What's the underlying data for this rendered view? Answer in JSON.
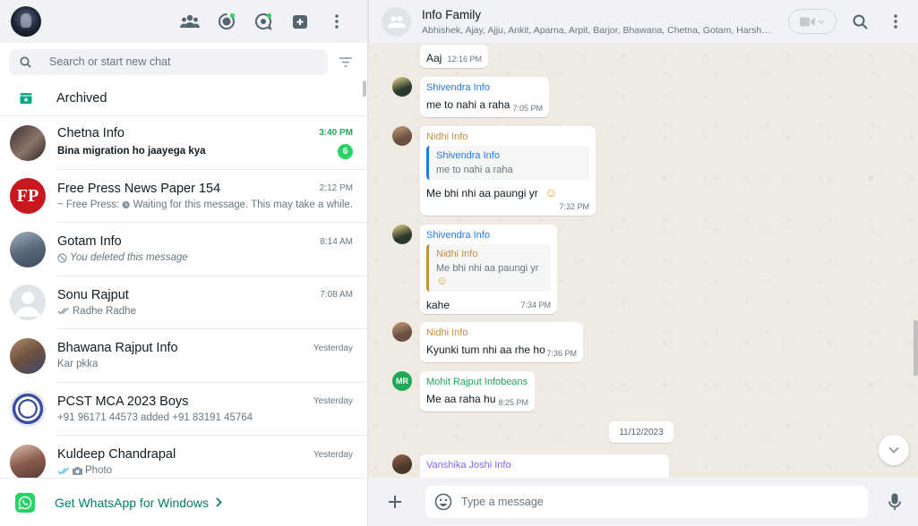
{
  "sidebar": {
    "header_icons": [
      "communities-icon",
      "status-icon",
      "channels-icon",
      "new-chat-icon",
      "menu-icon"
    ],
    "search_placeholder": "Search or start new chat",
    "archived_label": "Archived",
    "chats": [
      {
        "name": "Chetna Info",
        "time": "3:40 PM",
        "preview": "Bina migration ho jaayega kya",
        "unread": "6"
      },
      {
        "name": "Free Press News Paper 154",
        "time": "2:12 PM",
        "preview_prefix": "~ Free Press:",
        "preview": "Waiting for this message. This may take a while."
      },
      {
        "name": "Gotam Info",
        "time": "8:14 AM",
        "preview": "You deleted this message"
      },
      {
        "name": "Sonu Rajput",
        "time": "7:08 AM",
        "preview": "Radhe Radhe"
      },
      {
        "name": "Bhawana Rajput Info",
        "time": "Yesterday",
        "preview": "Kar pkka"
      },
      {
        "name": "PCST MCA 2023 Boys",
        "time": "Yesterday",
        "preview": "+91 96171 44573 added +91 83191 45764"
      },
      {
        "name": "Kuldeep Chandrapal",
        "time": "Yesterday",
        "preview": "Photo"
      }
    ],
    "footer_label": "Get WhatsApp for Windows"
  },
  "conversation": {
    "group_name": "Info Family",
    "members": "Abhishek, Ajay, Ajju, Ankit, Aparna, Arpit, Barjor, Bhawana, Chetna, Gotam, Harshit, Kuldeep",
    "messages": [
      {
        "text": "Aaj",
        "time": "12:16 PM"
      },
      {
        "sender": "Shivendra Info",
        "text": "me to nahi a raha",
        "time": "7:05 PM"
      },
      {
        "sender": "Nidhi Info",
        "quote_sender": "Shivendra Info",
        "quote_text": "me to nahi a raha",
        "text": "Me bhi nhi aa paungi yr",
        "emoji": "☺",
        "time": "7:32 PM"
      },
      {
        "sender": "Shivendra Info",
        "quote_sender": "Nidhi Info",
        "quote_text": "Me bhi nhi aa paungi yr",
        "quote_emoji": "☺",
        "text": "kahe",
        "time": "7:34 PM"
      },
      {
        "sender": "Nidhi Info",
        "text": "Kyunki tum nhi aa rhe ho",
        "time": "7:36 PM"
      },
      {
        "sender": "Mohit Rajput Infobeans",
        "avatar_initials": "MR",
        "text": "Me aa raha hu",
        "time": "8:25 PM"
      },
      {
        "sender": "Vanshika Joshi Info"
      }
    ],
    "date_separator": "11/12/2023",
    "composer_placeholder": "Type a message",
    "colors": {
      "shivendra": "#1f7aec",
      "nidhi": "#c4903c",
      "mohit": "#1fa855",
      "vanshika": "#7f66ff",
      "accent": "#25d366"
    }
  }
}
